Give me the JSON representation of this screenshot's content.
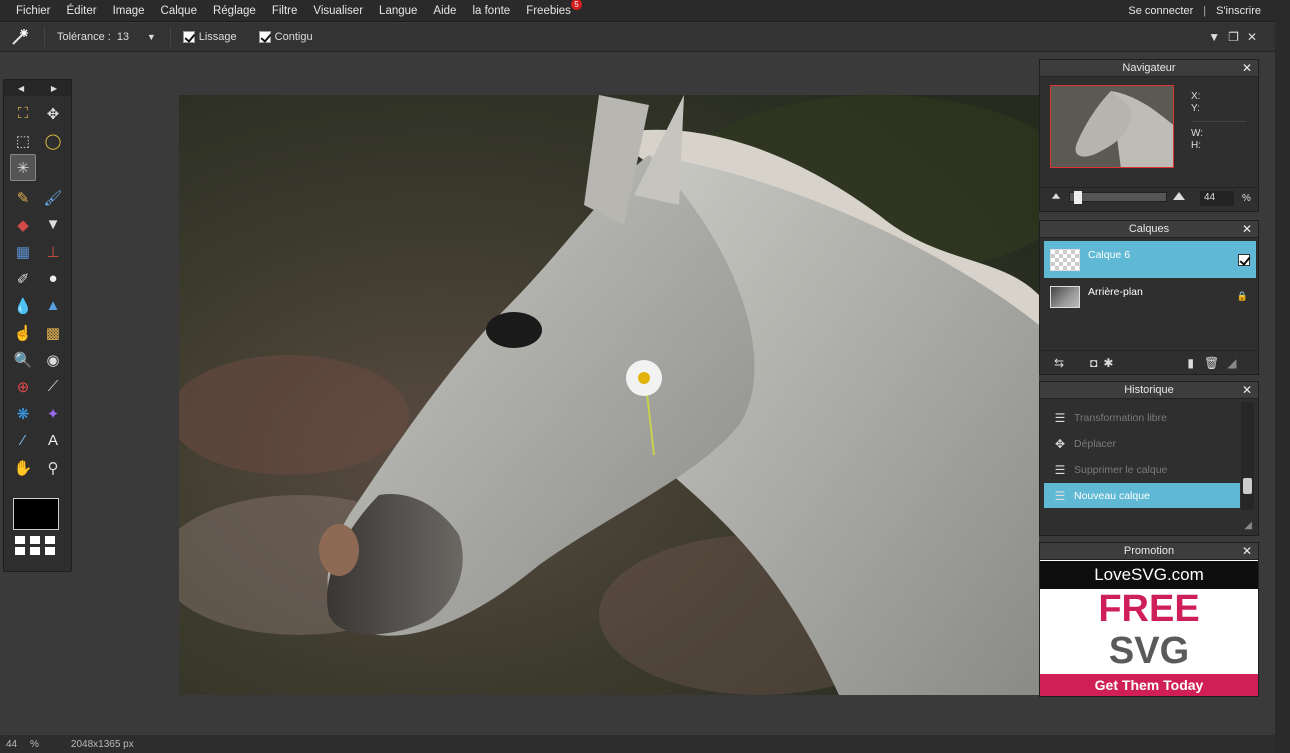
{
  "menu": {
    "items": [
      "Fichier",
      "Éditer",
      "Image",
      "Calque",
      "Réglage",
      "Filtre",
      "Visualiser",
      "Langue",
      "Aide",
      "la fonte",
      "Freebies"
    ],
    "freebies_badge": "5",
    "login": "Se connecter",
    "separator": "|",
    "signup": "S'inscrire"
  },
  "options": {
    "tolerance_label": "Tolérance :",
    "tolerance_value": "13",
    "smoothing_label": "Lissage",
    "smoothing_checked": true,
    "contiguous_label": "Contigu",
    "contiguous_checked": true
  },
  "tools": [
    {
      "name": "crop-tool",
      "glyph": "⛶"
    },
    {
      "name": "move-tool",
      "glyph": "✥"
    },
    {
      "name": "marquee-tool",
      "glyph": "⬚"
    },
    {
      "name": "lasso-tool",
      "glyph": "◯"
    },
    {
      "name": "magic-wand-tool",
      "glyph": "✳"
    },
    {
      "name": "empty-slot",
      "glyph": ""
    },
    {
      "name": "pencil-tool",
      "glyph": "✎"
    },
    {
      "name": "brush-tool",
      "glyph": "🖌"
    },
    {
      "name": "eraser-tool",
      "glyph": "◆"
    },
    {
      "name": "paint-bucket-tool",
      "glyph": "▼"
    },
    {
      "name": "gradient-tool",
      "glyph": "▦"
    },
    {
      "name": "clone-stamp-tool",
      "glyph": "⊥"
    },
    {
      "name": "color-replace-tool",
      "glyph": "✐"
    },
    {
      "name": "shape-tool",
      "glyph": "●"
    },
    {
      "name": "blur-tool",
      "glyph": "💧"
    },
    {
      "name": "sharpen-tool",
      "glyph": "▲"
    },
    {
      "name": "smudge-tool",
      "glyph": "☝"
    },
    {
      "name": "sponge-tool",
      "glyph": "▩"
    },
    {
      "name": "dodge-tool",
      "glyph": "🔍"
    },
    {
      "name": "burn-tool",
      "glyph": "◉"
    },
    {
      "name": "red-eye-tool",
      "glyph": "⊕"
    },
    {
      "name": "spot-heal-tool",
      "glyph": "⟋"
    },
    {
      "name": "bloat-tool",
      "glyph": "❋"
    },
    {
      "name": "pinch-tool",
      "glyph": "✦"
    },
    {
      "name": "color-picker-tool",
      "glyph": "⁄"
    },
    {
      "name": "type-tool",
      "glyph": "A"
    },
    {
      "name": "hand-tool",
      "glyph": "✋"
    },
    {
      "name": "zoom-tool",
      "glyph": "⚲"
    }
  ],
  "navigator": {
    "title": "Navigateur",
    "x_label": "X:",
    "y_label": "Y:",
    "w_label": "W:",
    "h_label": "H:",
    "zoom_value": "44",
    "zoom_unit": "%",
    "zoom_fraction": 0.03
  },
  "layers": {
    "title": "Calques",
    "items": [
      {
        "name": "Calque 6",
        "selected": true,
        "visible": true
      },
      {
        "name": "Arrière-plan",
        "selected": false,
        "locked": true
      }
    ]
  },
  "history": {
    "title": "Historique",
    "items": [
      {
        "label": "Transformation libre",
        "selected": false
      },
      {
        "label": "Déplacer",
        "selected": false
      },
      {
        "label": "Supprimer le calque",
        "selected": false
      },
      {
        "label": "Nouveau calque",
        "selected": true
      }
    ]
  },
  "promo": {
    "title": "Promotion",
    "logo": "LoveSVG.com",
    "headline": "FREE",
    "subhead": "SVG",
    "cta": "Get Them Today"
  },
  "status": {
    "zoom": "44",
    "zoom_unit": "%",
    "dimensions": "2048x1365 px"
  },
  "colors": {
    "accent": "#5fb9d4",
    "promo_pink": "#d01f57",
    "badge_red": "#d21e1e"
  }
}
